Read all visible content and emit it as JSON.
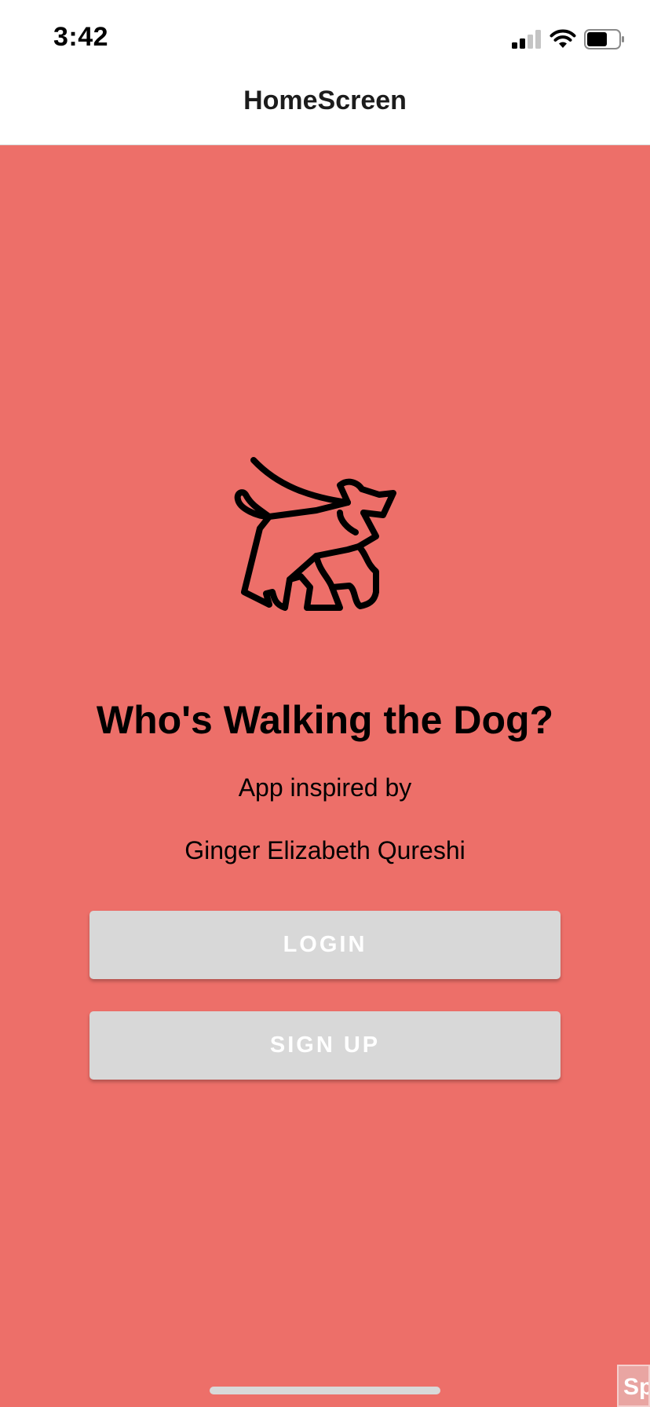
{
  "status_bar": {
    "time": "3:42",
    "icons": [
      "cellular-signal-icon",
      "wifi-icon",
      "battery-icon"
    ]
  },
  "nav": {
    "title": "HomeScreen"
  },
  "main": {
    "logo_icon": "dog-on-leash-icon",
    "headline": "Who's Walking the Dog?",
    "subtitle_line1": "App inspired by",
    "subtitle_line2": "Ginger Elizabeth Qureshi"
  },
  "buttons": {
    "login_label": "LOGIN",
    "signup_label": "SIGN UP"
  },
  "corner_badge": {
    "text": "Sp"
  },
  "colors": {
    "background": "#ED6F69",
    "button": "#D8D8D8",
    "button_text": "#FFFFFF",
    "header": "#FFFFFF"
  }
}
